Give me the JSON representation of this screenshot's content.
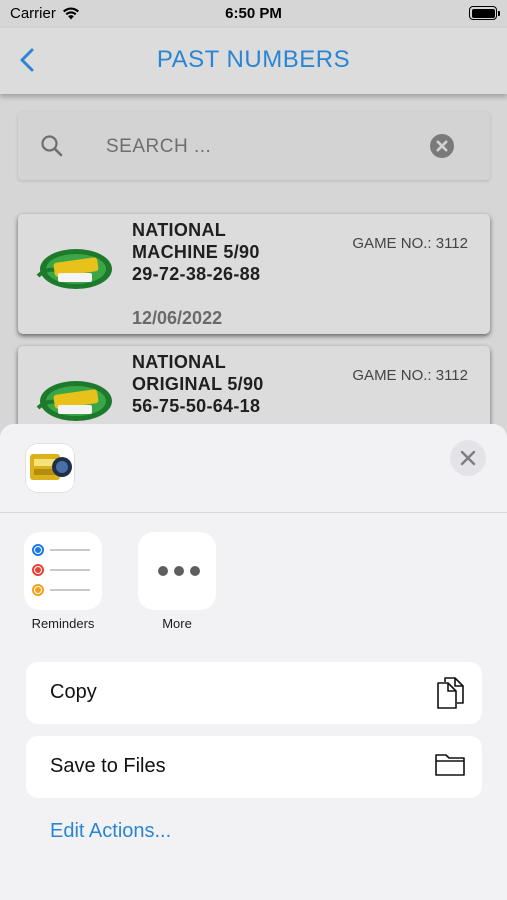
{
  "status": {
    "carrier": "Carrier",
    "time": "6:50 PM"
  },
  "nav": {
    "title": "PAST NUMBERS",
    "back_icon": "chevron-left-icon",
    "accent": "#2a86d4"
  },
  "search": {
    "placeholder": "SEARCH ..."
  },
  "results": [
    {
      "line1": "NATIONAL",
      "line2": "MACHINE 5/90",
      "numbers": "29-72-38-26-88",
      "game": "GAME NO.: 3112",
      "date": "12/06/2022"
    },
    {
      "line1": "NATIONAL",
      "line2": "ORIGINAL 5/90",
      "numbers": "56-75-50-64-18",
      "game": "GAME NO.: 3112"
    }
  ],
  "share_sheet": {
    "apps": [
      {
        "label": "Reminders",
        "icon": "reminders-icon"
      },
      {
        "label": "More",
        "icon": "more-icon"
      }
    ],
    "actions": [
      {
        "label": "Copy",
        "icon": "copy-icon"
      },
      {
        "label": "Save to Files",
        "icon": "folder-icon"
      }
    ],
    "edit_actions": "Edit Actions..."
  }
}
